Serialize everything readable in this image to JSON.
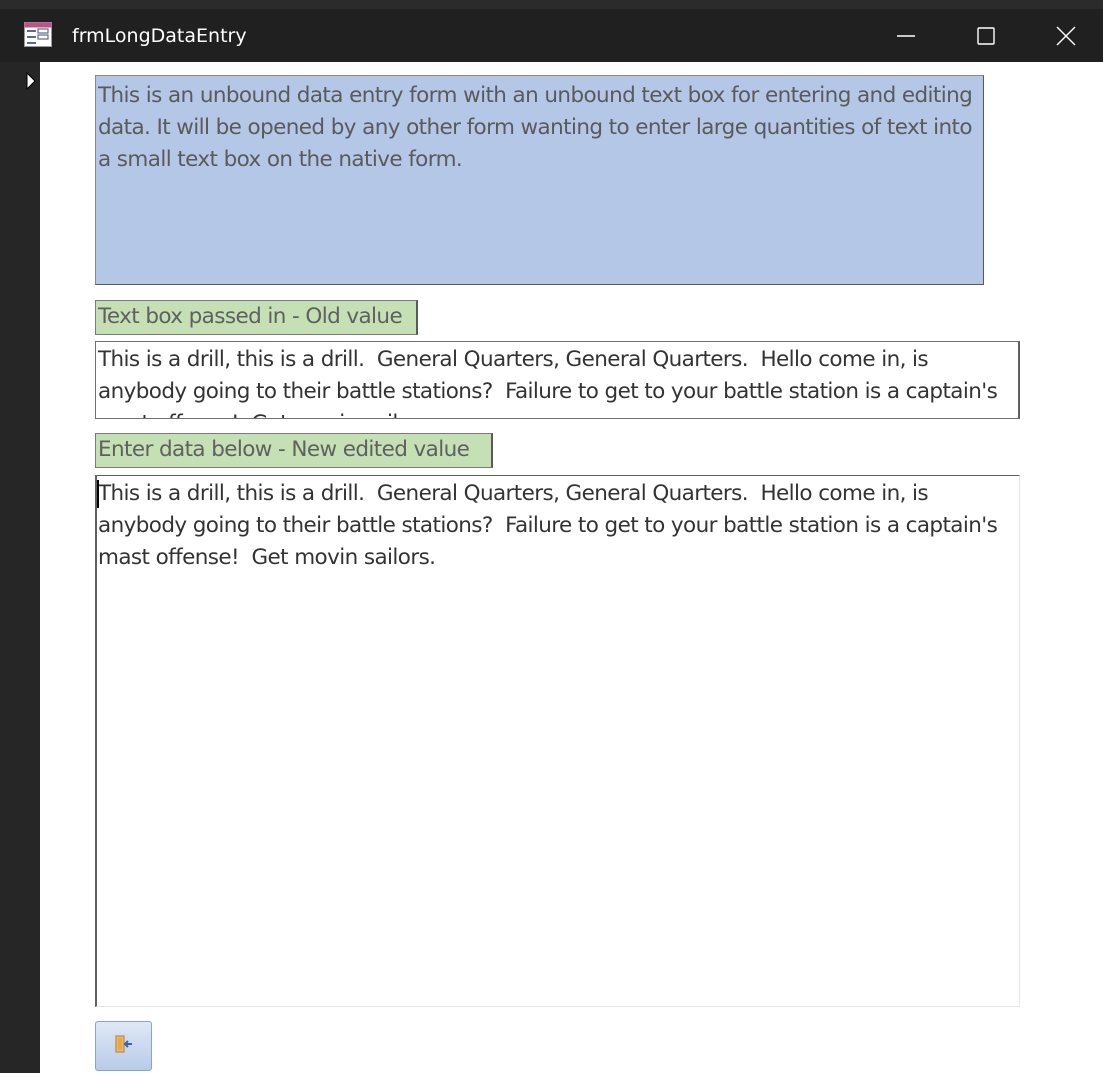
{
  "window": {
    "title": "frmLongDataEntry",
    "icons": {
      "app": "form-icon",
      "minimize": "minimize-icon",
      "maximize": "maximize-icon",
      "close": "close-icon"
    }
  },
  "record_selector": {
    "icon": "current-record-arrow-icon"
  },
  "form": {
    "description": "This is an unbound data entry form with an unbound text box for entering and editing data.  It will be opened by any other form wanting to enter large quantities of text into a small text box on the native form.",
    "old_value_label": "Text box passed in - Old value",
    "old_value": "This is a drill, this is a drill.  General Quarters, General Quarters.  Hello come in, is anybody going to their battle stations?  Failure to get to your battle station is a captain's mast offense!  Get movin sailors.",
    "new_value_label": "Enter data below - New edited value",
    "new_value": "This is a drill, this is a drill.  General Quarters, General Quarters.  Hello come in, is anybody going to their battle stations?  Failure to get to your battle station is a captain's mast offense!  Get movin sailors.",
    "close_button_icon": "exit-door-icon"
  },
  "colors": {
    "description_bg": "#b4c7e7",
    "label_bg": "#c5e0b4",
    "titlebar_bg": "#202020"
  }
}
